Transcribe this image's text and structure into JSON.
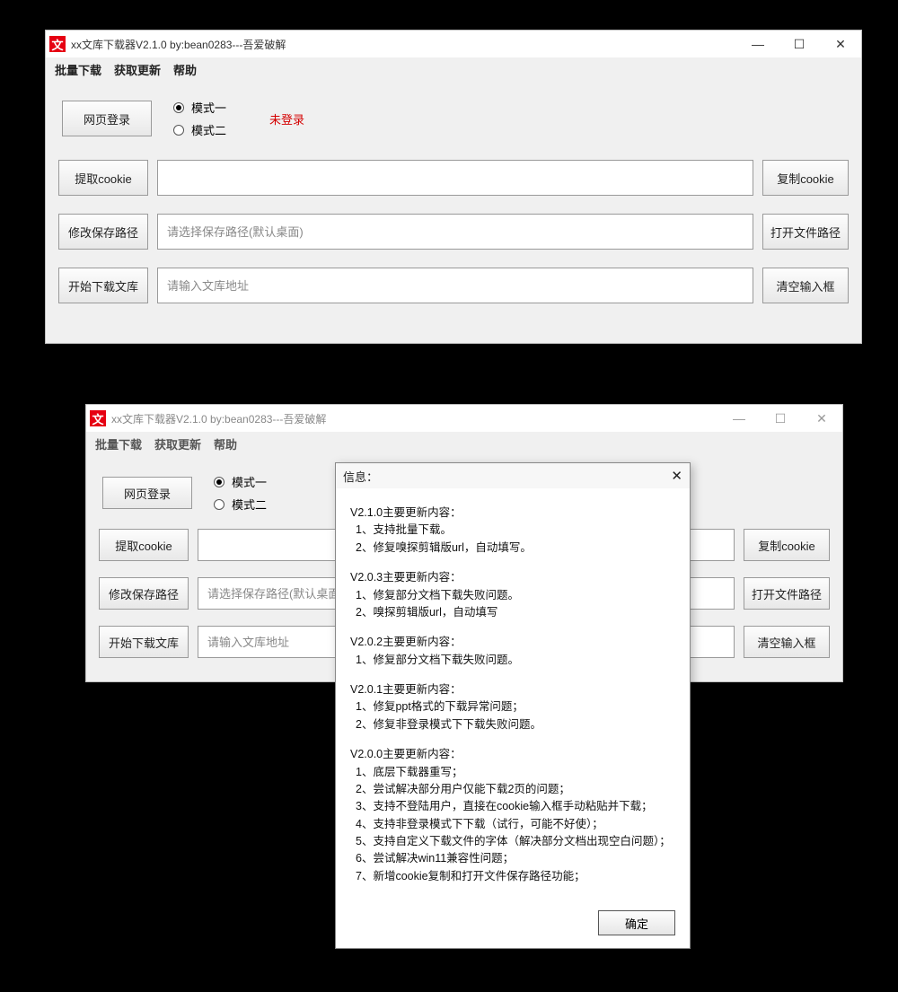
{
  "title": "xx文库下载器V2.1.0  by:bean0283---吾爱破解",
  "menu": {
    "batch": "批量下载",
    "update": "获取更新",
    "help": "帮助"
  },
  "buttons": {
    "web_login": "网页登录",
    "extract_cookie": "提取cookie",
    "copy_cookie": "复制cookie",
    "change_path": "修改保存路径",
    "open_path": "打开文件路径",
    "start_download": "开始下载文库",
    "clear_input": "清空输入框"
  },
  "radios": {
    "mode1": "模式一",
    "mode2": "模式二"
  },
  "status": {
    "not_logged_in": "未登录"
  },
  "placeholders": {
    "cookie": "",
    "path": "请选择保存路径(默认桌面)",
    "url": "请输入文库地址"
  },
  "dialog": {
    "title": "信息：",
    "ok": "确定",
    "changelog": [
      {
        "heading": "V2.1.0主要更新内容：",
        "items": [
          "1、支持批量下载。",
          "2、修复嗅探剪辑版url，自动填写。"
        ]
      },
      {
        "heading": "V2.0.3主要更新内容：",
        "items": [
          "1、修复部分文档下载失败问题。",
          "2、嗅探剪辑版url，自动填写"
        ]
      },
      {
        "heading": "V2.0.2主要更新内容：",
        "items": [
          "1、修复部分文档下载失败问题。"
        ]
      },
      {
        "heading": "V2.0.1主要更新内容：",
        "items": [
          "1、修复ppt格式的下载异常问题；",
          "2、修复非登录模式下下载失败问题。"
        ]
      },
      {
        "heading": "V2.0.0主要更新内容：",
        "items": [
          "1、底层下载器重写；",
          "2、尝试解决部分用户仅能下载2页的问题；",
          "3、支持不登陆用户，直接在cookie输入框手动粘贴并下载；",
          "4、支持非登录模式下下载（试行，可能不好使）；",
          "5、支持自定义下载文件的字体（解决部分文档出现空白问题）；",
          "6、尝试解决win11兼容性问题；",
          "7、新增cookie复制和打开文件保存路径功能；"
        ]
      }
    ]
  }
}
